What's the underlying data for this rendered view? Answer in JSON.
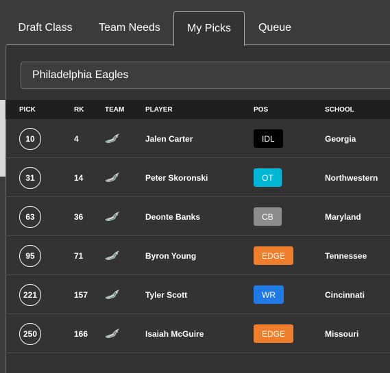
{
  "tabs": [
    {
      "label": "Draft Class"
    },
    {
      "label": "Team Needs"
    },
    {
      "label": "My Picks"
    },
    {
      "label": "Queue"
    }
  ],
  "active_tab": "My Picks",
  "team_select": {
    "value": "Philadelphia Eagles"
  },
  "table": {
    "headers": [
      "PICK",
      "RK",
      "TEAM",
      "PLAYER",
      "POS",
      "SCHOOL"
    ],
    "rows": [
      {
        "pick": "10",
        "rk": "4",
        "team_icon": "eagles-logo-icon",
        "player": "Jalen Carter",
        "pos": "IDL",
        "pos_color": "#000000",
        "pos_text_color": "#ffffff",
        "school": "Georgia"
      },
      {
        "pick": "31",
        "rk": "14",
        "team_icon": "eagles-logo-icon",
        "player": "Peter Skoronski",
        "pos": "OT",
        "pos_color": "#00b6d6",
        "pos_text_color": "#ffffff",
        "school": "Northwestern"
      },
      {
        "pick": "63",
        "rk": "36",
        "team_icon": "eagles-logo-icon",
        "player": "Deonte Banks",
        "pos": "CB",
        "pos_color": "#8c8c8c",
        "pos_text_color": "#ffffff",
        "school": "Maryland"
      },
      {
        "pick": "95",
        "rk": "71",
        "team_icon": "eagles-logo-icon",
        "player": "Byron Young",
        "pos": "EDGE",
        "pos_color": "#ee7d2c",
        "pos_text_color": "#ffffff",
        "school": "Tennessee"
      },
      {
        "pick": "221",
        "rk": "157",
        "team_icon": "eagles-logo-icon",
        "player": "Tyler Scott",
        "pos": "WR",
        "pos_color": "#1f7ae6",
        "pos_text_color": "#ffffff",
        "school": "Cincinnati"
      },
      {
        "pick": "250",
        "rk": "166",
        "team_icon": "eagles-logo-icon",
        "player": "Isaiah McGuire",
        "pos": "EDGE",
        "pos_color": "#ee7d2c",
        "pos_text_color": "#ffffff",
        "school": "Missouri"
      }
    ]
  },
  "colors": {
    "background": "#3b3b3b",
    "panel": "#333333",
    "header": "#1f1f1f",
    "text": "#ffffff"
  }
}
